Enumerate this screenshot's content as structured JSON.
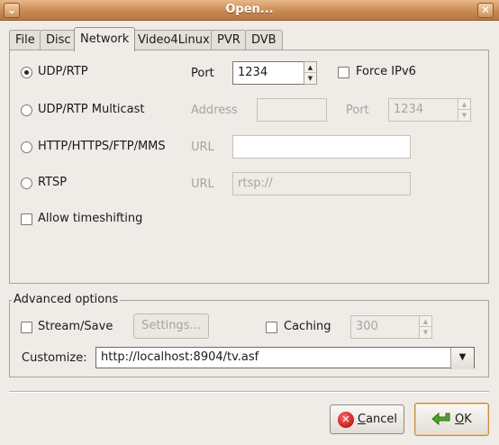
{
  "window": {
    "title": "Open..."
  },
  "tabs": [
    {
      "label": "File"
    },
    {
      "label": "Disc"
    },
    {
      "label": "Network"
    },
    {
      "label": "Video4Linux"
    },
    {
      "label": "PVR"
    },
    {
      "label": "DVB"
    }
  ],
  "network": {
    "udp": {
      "label": "UDP/RTP",
      "port_label": "Port",
      "port_value": "1234",
      "force_ipv6_label": "Force IPv6"
    },
    "multicast": {
      "label": "UDP/RTP Multicast",
      "address_label": "Address",
      "address_value": "",
      "port_label": "Port",
      "port_value": "1234"
    },
    "http": {
      "label": "HTTP/HTTPS/FTP/MMS",
      "url_label": "URL",
      "url_value": ""
    },
    "rtsp": {
      "label": "RTSP",
      "url_label": "URL",
      "url_value": "rtsp://"
    },
    "timeshift": {
      "label": "Allow timeshifting"
    }
  },
  "advanced": {
    "title": "Advanced options",
    "stream_save_label": "Stream/Save",
    "settings_label": "Settings...",
    "caching_label": "Caching",
    "caching_value": "300",
    "customize_label": "Customize:",
    "customize_value": "http://localhost:8904/tv.asf"
  },
  "buttons": {
    "cancel_prefix": "",
    "cancel_mnemonic": "C",
    "cancel_rest": "ancel",
    "ok_mnemonic": "O",
    "ok_rest": "K"
  },
  "colors": {
    "titlebar": "#c98a54",
    "ok_arrow": "#4ea42a",
    "cancel_icon": "#c41b1b"
  }
}
